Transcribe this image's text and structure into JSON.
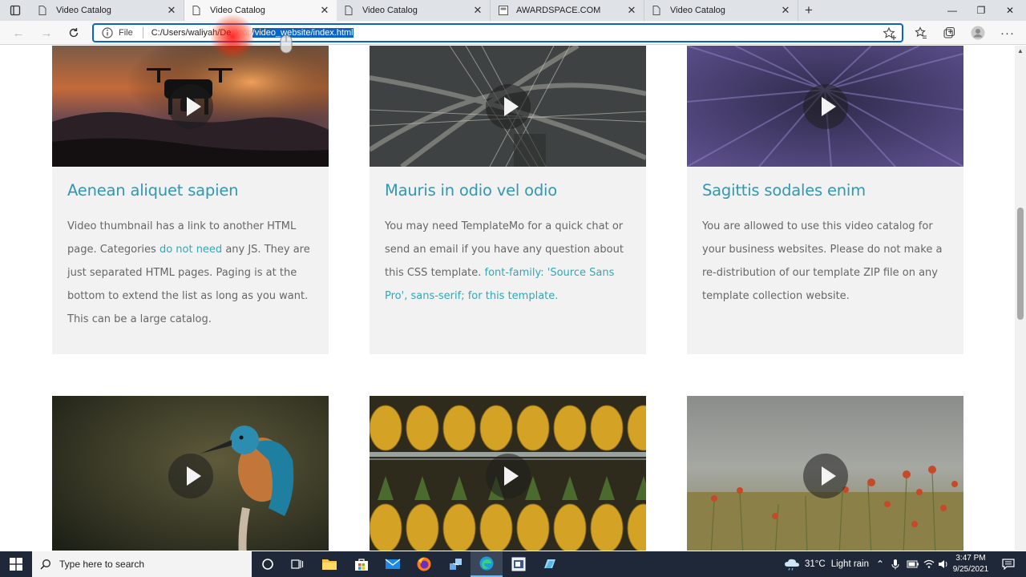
{
  "browser": {
    "tabs": [
      {
        "title": "Video Catalog",
        "active": false
      },
      {
        "title": "Video Catalog",
        "active": true
      },
      {
        "title": "Video Catalog",
        "active": false
      },
      {
        "title": "AWARDSPACE.COM",
        "active": false
      },
      {
        "title": "Video Catalog",
        "active": false
      }
    ],
    "address": {
      "scheme_label": "File",
      "url_prefix": "C:/Users/waliyah/De",
      "url_hidden": "sktop",
      "url_selected": "/video_website/index.html"
    },
    "window_controls": {
      "minimize": "—",
      "maximize": "❐",
      "close": "✕"
    }
  },
  "cards": [
    {
      "title": "Aenean aliquet sapien",
      "text_parts": [
        {
          "text": "Video thumbnail has a link to another HTML page. Categories ",
          "link": false
        },
        {
          "text": "do not need",
          "link": true
        },
        {
          "text": " any JS. They are just separated HTML pages. Paging is at the bottom to extend the list as long as you want. This can be a large catalog.",
          "link": false
        }
      ],
      "image": "drone-sunset"
    },
    {
      "title": "Mauris in odio vel odio",
      "text_parts": [
        {
          "text": "You may need TemplateMo for a quick chat or send an email if you have any question about this CSS template. ",
          "link": false
        },
        {
          "text": "font-family: 'Source Sans Pro', sans-serif; for this template.",
          "link": true
        }
      ],
      "image": "highway-bridge"
    },
    {
      "title": "Sagittis sodales enim",
      "text_parts": [
        {
          "text": "You are allowed to use this video catalog for your business websites. Please do not make a re-distribution of our template ZIP file on any template collection website.",
          "link": false
        }
      ],
      "image": "lavender-field"
    },
    {
      "title": "",
      "text_parts": [],
      "image": "kingfisher"
    },
    {
      "title": "",
      "text_parts": [],
      "image": "pineapples"
    },
    {
      "title": "",
      "text_parts": [],
      "image": "poppies-field"
    }
  ],
  "taskbar": {
    "search_placeholder": "Type here to search",
    "apps": [
      "task-view",
      "file-explorer",
      "microsoft-store",
      "mail",
      "firefox",
      "network-tool",
      "edge",
      "notepad-app",
      "hyper-v"
    ],
    "weather": {
      "temp": "31°C",
      "desc": "Light rain"
    },
    "time": "3:47 PM",
    "date": "9/25/2021"
  },
  "colors": {
    "link": "#33a7b5",
    "title": "#3297b0",
    "card_bg": "#f2f2f2",
    "selection": "#0a64c8"
  }
}
